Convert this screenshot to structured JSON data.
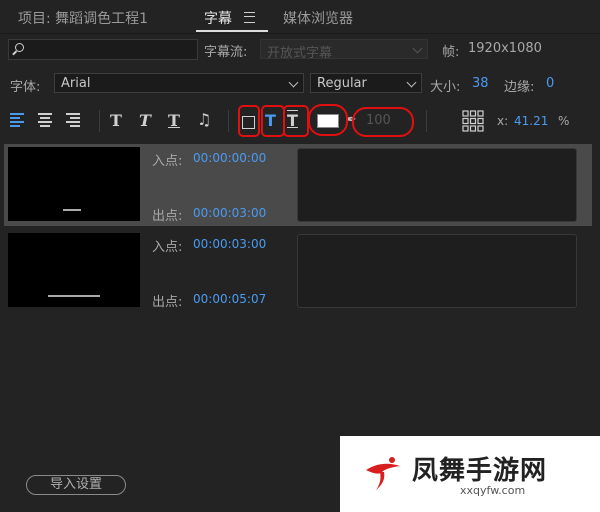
{
  "tabs": {
    "project": "项目: 舞蹈调色工程1",
    "captions": "字幕",
    "media_browser": "媒体浏览器"
  },
  "search": {
    "placeholder": ""
  },
  "caption_stream": {
    "label": "字幕流:",
    "value": "开放式字幕"
  },
  "frame": {
    "label": "帧:",
    "value": "1920x1080"
  },
  "font": {
    "label": "字体:",
    "family": "Arial",
    "style": "Regular"
  },
  "size": {
    "label": "大小:",
    "value": "38"
  },
  "edge": {
    "label": "边缘:",
    "value": "0"
  },
  "toolbar": {
    "opacity": "100",
    "x_label": "x:",
    "x_value": "41.21",
    "x_unit": "%"
  },
  "captions": [
    {
      "in_label": "入点:",
      "in_time": "00:00:00:00",
      "out_label": "出点:",
      "out_time": "00:00:03:00"
    },
    {
      "in_label": "入点:",
      "in_time": "00:00:03:00",
      "out_label": "出点:",
      "out_time": "00:00:05:07"
    }
  ],
  "import_button": "导入设置",
  "watermark": {
    "name": "凤舞手游网",
    "url": "xxqyfw.com"
  },
  "colors": {
    "accent": "#4a9bf0",
    "annotation": "#e01010",
    "selected_row": "#4a4a4a"
  }
}
